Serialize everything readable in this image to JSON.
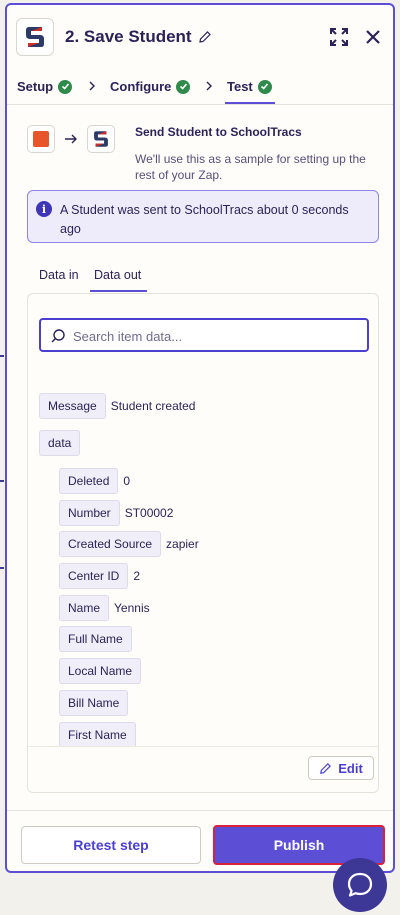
{
  "header": {
    "title": "2. Save Student",
    "app_icon": "schooltracs-logo",
    "edit_icon": "pencil-icon",
    "expand_icon": "expand-icon",
    "close_icon": "close-icon"
  },
  "tabs": [
    {
      "label": "Setup",
      "status": "complete"
    },
    {
      "label": "Configure",
      "status": "complete"
    },
    {
      "label": "Test",
      "status": "complete",
      "active": true
    }
  ],
  "action": {
    "title": "Send Student to SchoolTracs",
    "subtitle": "We'll use this as a sample for setting up the rest of your Zap."
  },
  "info": {
    "text": "A Student was sent to SchoolTracs about 0 seconds ago"
  },
  "data_tabs": [
    {
      "label": "Data in"
    },
    {
      "label": "Data out",
      "active": true
    }
  ],
  "search": {
    "placeholder": "Search item data...",
    "value": ""
  },
  "fields": {
    "message": {
      "key": "Message",
      "value": "Student created"
    },
    "data_key": "data",
    "deleted": {
      "key": "Deleted",
      "value": "0"
    },
    "number": {
      "key": "Number",
      "value": "ST00002"
    },
    "created_source": {
      "key": "Created Source",
      "value": "zapier"
    },
    "center_id": {
      "key": "Center ID",
      "value": "2"
    },
    "name": {
      "key": "Name",
      "value": "Yennis"
    },
    "full_name": {
      "key": "Full Name",
      "value": ""
    },
    "local_name": {
      "key": "Local Name",
      "value": ""
    },
    "bill_name": {
      "key": "Bill Name",
      "value": ""
    },
    "first_name": {
      "key": "First Name",
      "value": ""
    }
  },
  "edit_label": "Edit",
  "footer": {
    "retest_label": "Retest step",
    "publish_label": "Publish"
  },
  "colors": {
    "accent": "#5c4fd6",
    "success": "#2f8a4c",
    "publish_border": "#d8223c",
    "chat": "#3d3795"
  }
}
